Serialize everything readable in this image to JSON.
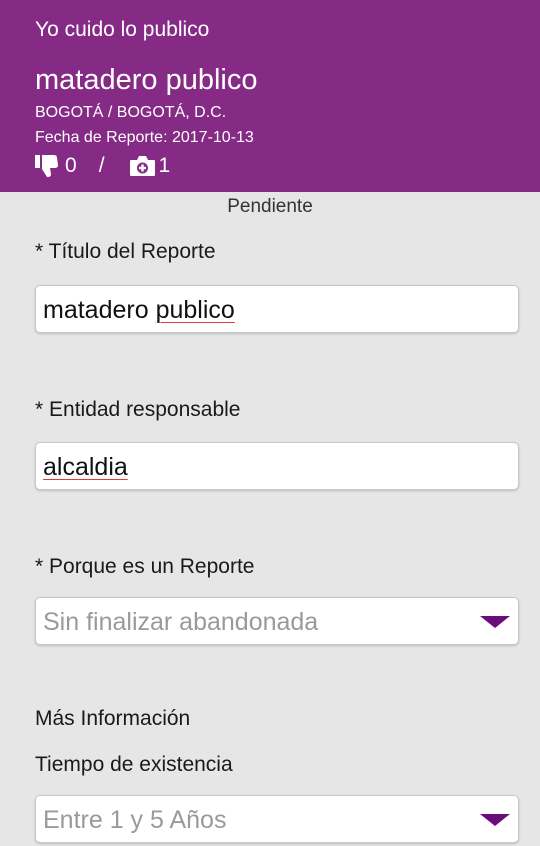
{
  "header": {
    "app_title": "Yo cuido lo publico",
    "report_name": "matadero publico",
    "location": "BOGOTÁ / BOGOTÁ, D.C.",
    "date_label": "Fecha de Reporte:",
    "date_value": "2017-10-13",
    "dislikes": "0",
    "separator": "/",
    "photos": "1",
    "colors": {
      "background": "#852b85",
      "text": "#ffffff"
    }
  },
  "status": "Pendiente",
  "form": {
    "title_label": "* Título del Reporte",
    "title_value_a": "matadero ",
    "title_value_b": "publico",
    "entity_label": "* Entidad responsable",
    "entity_value": "alcaldia",
    "reason_label": "* Porque es un Reporte",
    "reason_value": "Sin finalizar abandonada",
    "more_info_label": "Más Información",
    "time_label": "Tiempo de existencia",
    "time_value": "Entre 1 y 5 Años"
  },
  "icons": [
    "thumbs-down-icon",
    "camera-icon",
    "dropdown-arrow-icon"
  ],
  "colors": {
    "accent": "#852b85",
    "arrow": "#6a0c7a",
    "spellcheck": "#e53935"
  }
}
